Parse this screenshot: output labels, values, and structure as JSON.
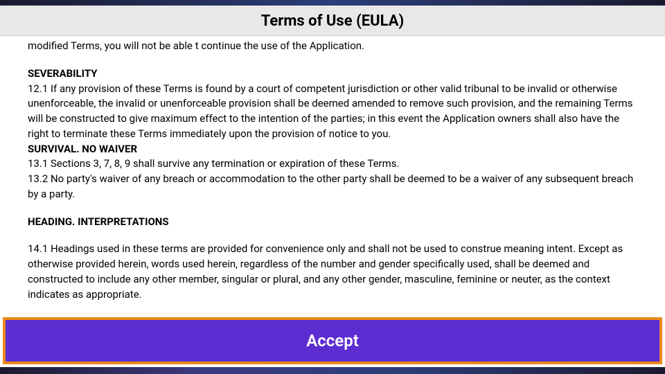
{
  "header": {
    "title": "Terms of Use (EULA)"
  },
  "content": {
    "truncated_line": "modified Terms, you will not be able t continue the use of the Application.",
    "severability_heading": "SEVERABILITY",
    "severability_body": "12.1 If any provision of these Terms is found by a court of competent jurisdiction or other valid tribunal to be invalid or otherwise unenforceable, the invalid or unenforceable provision shall be deemed amended to remove such provision, and the remaining Terms will be constructed to give maximum effect to the intention of the parties; in this event the Application owners shall also have the right to terminate these Terms immediately upon the provision of notice to you.",
    "survival_heading": "SURVIVAL. NO WAIVER",
    "survival_body_1": "13.1 Sections 3, 7, 8, 9 shall survive any termination or expiration of these Terms.",
    "survival_body_2": "13.2 No party's waiver of any breach or accommodation to the other party shall be deemed to be a waiver of any subsequent breach by a party.",
    "heading_interp_heading": "HEADING. INTERPRETATIONS",
    "heading_interp_body": "14.1 Headings used in these terms are provided for convenience only and shall not be used to construe meaning intent. Except as otherwise provided herein, words used herein, regardless of the number and gender specifically used, shall be deemed and constructed to include any other member, singular or plural, and any other gender, masculine, feminine or neuter, as the context indicates as appropriate."
  },
  "footer": {
    "accept_label": "Accept"
  }
}
